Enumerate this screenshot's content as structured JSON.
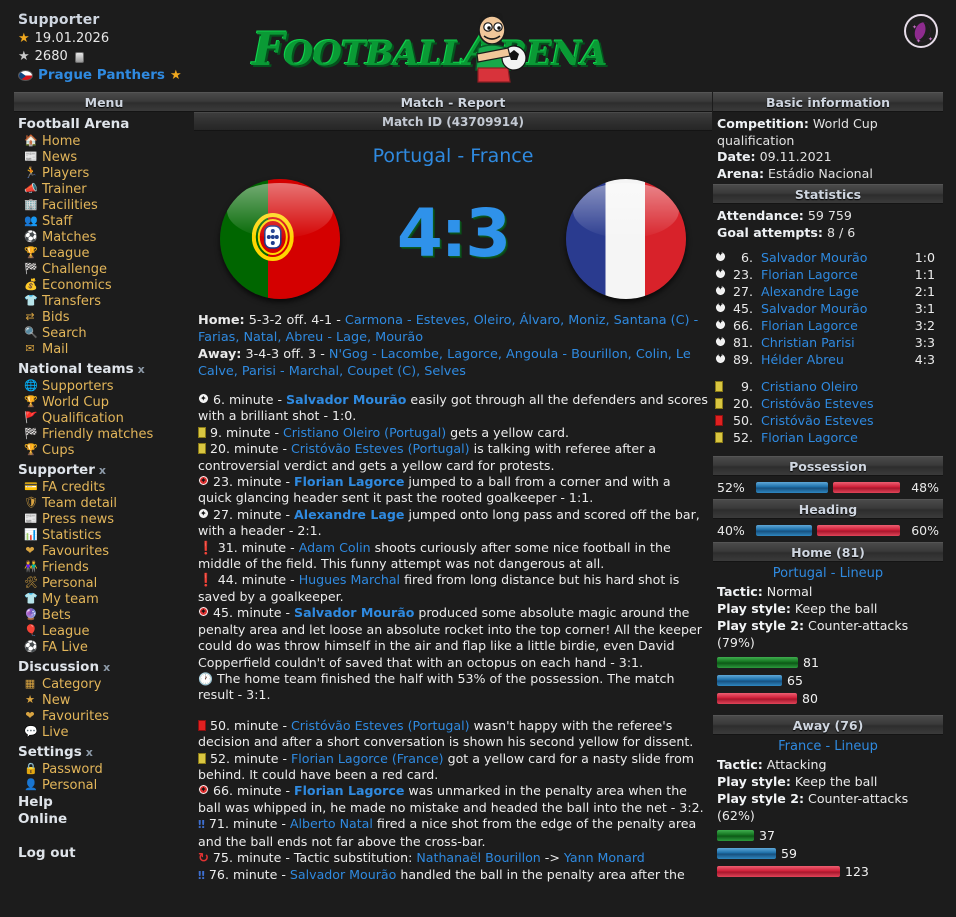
{
  "header": {
    "supporter_title": "Supporter",
    "expiry_date": "19.01.2026",
    "credits": "2680",
    "team_name": "Prague Panthers",
    "logo_part1": "F",
    "logo_part2": "OOTBALL",
    "logo_part3": "A",
    "logo_part4": "RENA",
    "theme_toggle": "moon-icon"
  },
  "sidebar": {
    "menu_label": "Menu",
    "groups": [
      {
        "title": "Football Arena",
        "close": "",
        "items": [
          {
            "label": "Home",
            "icon": "house-icon",
            "glyph": "🏠"
          },
          {
            "label": "News",
            "icon": "newspaper-icon",
            "glyph": "📰"
          },
          {
            "label": "Players",
            "icon": "player-icon",
            "glyph": "🏃"
          },
          {
            "label": "Trainer",
            "icon": "trainer-icon",
            "glyph": "📣"
          },
          {
            "label": "Facilities",
            "icon": "building-icon",
            "glyph": "🏢"
          },
          {
            "label": "Staff",
            "icon": "staff-icon",
            "glyph": "👥"
          },
          {
            "label": "Matches",
            "icon": "football-icon",
            "glyph": "⚽"
          },
          {
            "label": "League",
            "icon": "trophy-icon",
            "glyph": "🏆"
          },
          {
            "label": "Challenge",
            "icon": "flag-icon",
            "glyph": "🏁"
          },
          {
            "label": "Economics",
            "icon": "money-icon",
            "glyph": "💰"
          },
          {
            "label": "Transfers",
            "icon": "shirt-icon",
            "glyph": "👕"
          },
          {
            "label": "Bids",
            "icon": "arrows-icon",
            "glyph": "⇄"
          },
          {
            "label": "Search",
            "icon": "magnifier-icon",
            "glyph": "🔍"
          },
          {
            "label": "Mail",
            "icon": "mail-icon",
            "glyph": "✉"
          }
        ]
      },
      {
        "title": "National teams",
        "close": "x",
        "items": [
          {
            "label": "Supporters",
            "icon": "globe-icon",
            "glyph": "🌐"
          },
          {
            "label": "World Cup",
            "icon": "trophy-icon",
            "glyph": "🏆"
          },
          {
            "label": "Qualification",
            "icon": "flag-icon",
            "glyph": "🚩"
          },
          {
            "label": "Friendly matches",
            "icon": "flag-icon",
            "glyph": "🏁"
          },
          {
            "label": "Cups",
            "icon": "cup-icon",
            "glyph": "🏆"
          }
        ]
      },
      {
        "title": "Supporter",
        "close": "x",
        "items": [
          {
            "label": "FA credits",
            "icon": "credits-icon",
            "glyph": "💳"
          },
          {
            "label": "Team detail",
            "icon": "shield-icon",
            "glyph": "🛡"
          },
          {
            "label": "Press news",
            "icon": "newspaper-icon",
            "glyph": "📰"
          },
          {
            "label": "Statistics",
            "icon": "chart-icon",
            "glyph": "📊"
          },
          {
            "label": "Favourites",
            "icon": "heart-icon",
            "glyph": "❤"
          },
          {
            "label": "Friends",
            "icon": "friends-icon",
            "glyph": "👫"
          },
          {
            "label": "Personal",
            "icon": "tools-icon",
            "glyph": "🛠"
          },
          {
            "label": "My team",
            "icon": "shirt-icon",
            "glyph": "👕"
          },
          {
            "label": "Bets",
            "icon": "ball-icon",
            "glyph": "🔮"
          },
          {
            "label": "League",
            "icon": "league-icon",
            "glyph": "🎈"
          },
          {
            "label": "FA Live",
            "icon": "football-icon",
            "glyph": "⚽"
          }
        ]
      },
      {
        "title": "Discussion",
        "close": "x",
        "items": [
          {
            "label": "Category",
            "icon": "grid-icon",
            "glyph": "▦"
          },
          {
            "label": "New",
            "icon": "star-icon",
            "glyph": "★"
          },
          {
            "label": "Favourites",
            "icon": "heart-icon",
            "glyph": "❤"
          },
          {
            "label": "Live",
            "icon": "speech-bubble-icon",
            "glyph": "💬"
          }
        ]
      },
      {
        "title": "Settings",
        "close": "x",
        "items": [
          {
            "label": "Password",
            "icon": "lock-icon",
            "glyph": "🔒"
          },
          {
            "label": "Personal",
            "icon": "user-icon",
            "glyph": "👤"
          }
        ]
      }
    ],
    "plain_links": [
      "Help",
      "Online"
    ],
    "logout": "Log out"
  },
  "main": {
    "page_header": "Match - Report",
    "match_id_header": "Match ID (43709914)",
    "title": "Portugal - France",
    "home_team": "Portugal",
    "away_team": "France",
    "score": "4:3",
    "lineups": {
      "home_prefix": "Home:",
      "home_formation": "5-3-2 off. 4-1 - ",
      "home_players": "Carmona - Esteves, Oleiro, Álvaro, Moniz, Santana (C) - Farias, Natal, Abreu - Lage, Mourão",
      "away_prefix": "Away:",
      "away_formation": "3-4-3 off. 3 - ",
      "away_players": "N'Gog - Lacombe, Lagorce, Angoula - Bourillon, Colin, Le Calve, Parisi - Marchal, Coupet (C), Selves"
    },
    "events": [
      {
        "icon": "goal-ball-icon",
        "icon_type": "ball-white",
        "minute": "6. minute",
        "player": "Salvador Mourão",
        "player_bold": true,
        "text": " easily got through all the defenders and scores with a brilliant shot - 1:0."
      },
      {
        "icon": "yellow-card-icon",
        "icon_type": "ycard",
        "minute": "9. minute",
        "player": "Cristiano Oleiro",
        "player_bold": false,
        "team": "(Portugal)",
        "text": " gets a yellow card."
      },
      {
        "icon": "yellow-card-icon",
        "icon_type": "ycard",
        "minute": "20. minute",
        "player": "Cristóvão Esteves",
        "player_bold": false,
        "team": "(Portugal)",
        "text": " is talking with referee after a controversial verdict and gets a yellow card for protests."
      },
      {
        "icon": "goal-ball-icon",
        "icon_type": "ball-red",
        "minute": "23. minute",
        "player": "Florian Lagorce",
        "player_bold": true,
        "text": " jumped to a ball from a corner and with a quick glancing header sent it past the rooted goalkeeper - 1:1."
      },
      {
        "icon": "goal-ball-icon",
        "icon_type": "ball-white",
        "minute": "27. minute",
        "player": "Alexandre Lage",
        "player_bold": true,
        "text": " jumped onto long pass and scored off the bar, with a header - 2:1."
      },
      {
        "icon": "chance-icon",
        "icon_type": "excl",
        "minute": "31. minute",
        "player": "Adam Colin",
        "player_bold": false,
        "text": " shoots curiously after some nice football in the middle of the field. This funny attempt was not dangerous at all."
      },
      {
        "icon": "chance-icon",
        "icon_type": "excl",
        "minute": "44. minute",
        "player": "Hugues Marchal",
        "player_bold": false,
        "text": " fired from long distance but his hard shot is saved by a goalkeeper."
      },
      {
        "icon": "goal-ball-icon",
        "icon_type": "ball-red",
        "minute": "45. minute",
        "player": "Salvador Mourão",
        "player_bold": true,
        "text": " produced some absolute magic around the penalty area and let loose an absolute rocket into the top corner! All the keeper could do was throw himself in the air and flap like a little birdie, even David Copperfield couldn't of saved that with an octopus on each hand - 3:1."
      },
      {
        "icon": "halftime-clock-icon",
        "icon_type": "clock",
        "minute": "",
        "player": "",
        "player_bold": false,
        "text": "The home team finished the half with 53% of the possession. The match result - 3:1."
      },
      {
        "gap": true
      },
      {
        "icon": "red-card-icon",
        "icon_type": "rcard",
        "minute": "50. minute",
        "player": "Cristóvão Esteves",
        "player_bold": false,
        "team": "(Portugal)",
        "text": " wasn't happy with the referee's decision and after a short conversation is shown his second yellow for dissent."
      },
      {
        "icon": "yellow-card-icon",
        "icon_type": "ycard",
        "minute": "52. minute",
        "player": "Florian Lagorce",
        "player_bold": false,
        "team": "(France)",
        "text": " got a yellow card for a nasty slide from behind. It could have been a red card."
      },
      {
        "icon": "goal-ball-icon",
        "icon_type": "ball-red",
        "minute": "66. minute",
        "player": "Florian Lagorce",
        "player_bold": true,
        "text": " was unmarked in the penalty area when the ball was whipped in, he made no mistake and headed the ball into the net - 3:2."
      },
      {
        "icon": "big-chance-icon",
        "icon_type": "dexcl",
        "minute": "71. minute",
        "player": "Alberto Natal",
        "player_bold": false,
        "text": " fired a nice shot from the edge of the penalty area and the ball ends not far above the cross-bar."
      },
      {
        "icon": "substitution-icon",
        "icon_type": "sub",
        "minute": "75. minute",
        "player": "",
        "player_bold": false,
        "text": "Tactic substitution: ",
        "sub_out": "Nathanaël Bourillon",
        "sub_arrow": " -> ",
        "sub_in": "Yann Monard"
      },
      {
        "icon": "big-chance-icon",
        "icon_type": "dexcl",
        "minute": "76. minute",
        "player": "Salvador Mourão",
        "player_bold": false,
        "text": " handled the ball in the penalty area after the"
      }
    ]
  },
  "right": {
    "basic_info_header": "Basic information",
    "competition_label": "Competition:",
    "competition_value": "World Cup qualification",
    "date_label": "Date:",
    "date_value": "09.11.2021",
    "arena_label": "Arena:",
    "arena_value": "Estádio Nacional",
    "statistics_header": "Statistics",
    "attendance_label": "Attendance:",
    "attendance_value": "59 759",
    "goal_attempts_label": "Goal attempts:",
    "goal_attempts_value": "8 / 6",
    "goals": [
      {
        "icon": "football-icon",
        "minute": "6.",
        "player": "Salvador Mourão",
        "result": "1:0"
      },
      {
        "icon": "football-icon",
        "minute": "23.",
        "player": "Florian Lagorce",
        "result": "1:1"
      },
      {
        "icon": "football-icon",
        "minute": "27.",
        "player": "Alexandre Lage",
        "result": "2:1"
      },
      {
        "icon": "football-icon",
        "minute": "45.",
        "player": "Salvador Mourão",
        "result": "3:1"
      },
      {
        "icon": "football-icon",
        "minute": "66.",
        "player": "Florian Lagorce",
        "result": "3:2"
      },
      {
        "icon": "football-icon",
        "minute": "81.",
        "player": "Christian Parisi",
        "result": "3:3"
      },
      {
        "icon": "football-icon",
        "minute": "89.",
        "player": "Hélder Abreu",
        "result": "4:3"
      }
    ],
    "cards": [
      {
        "card": "yellow",
        "minute": "9.",
        "player": "Cristiano Oleiro"
      },
      {
        "card": "yellow",
        "minute": "20.",
        "player": "Cristóvão Esteves"
      },
      {
        "card": "red",
        "minute": "50.",
        "player": "Cristóvão Esteves"
      },
      {
        "card": "yellow",
        "minute": "52.",
        "player": "Florian Lagorce"
      }
    ],
    "possession_header": "Possession",
    "possession_home": "52%",
    "possession_away": "48%",
    "heading_header": "Heading",
    "heading_home": "40%",
    "heading_away": "60%",
    "home_header": "Home (81)",
    "home_lineup_link": "Portugal - Lineup",
    "home_tactic_label": "Tactic:",
    "home_tactic_value": "Normal",
    "home_style_label": "Play style:",
    "home_style_value": "Keep the ball",
    "home_style2_label": "Play style 2:",
    "home_style2_value": "Counter-attacks (79%)",
    "home_bars": [
      {
        "color": "green",
        "value": "81"
      },
      {
        "color": "blue",
        "value": "65"
      },
      {
        "color": "red",
        "value": "80"
      }
    ],
    "away_header": "Away (76)",
    "away_lineup_link": "France - Lineup",
    "away_tactic_label": "Tactic:",
    "away_tactic_value": "Attacking",
    "away_style_label": "Play style:",
    "away_style_value": "Keep the ball",
    "away_style2_label": "Play style 2:",
    "away_style2_value": "Counter-attacks (62%)",
    "away_bars": [
      {
        "color": "green",
        "value": "37"
      },
      {
        "color": "blue",
        "value": "59"
      },
      {
        "color": "red",
        "value": "123"
      }
    ]
  },
  "colors": {
    "link": "#2f8ae0",
    "menu": "#e3b65a",
    "score": "#2f92ea",
    "green": "#0a9a35",
    "bar_blue": "#1c6ea8",
    "bar_red": "#cf1f38",
    "bar_green": "#13721f"
  }
}
